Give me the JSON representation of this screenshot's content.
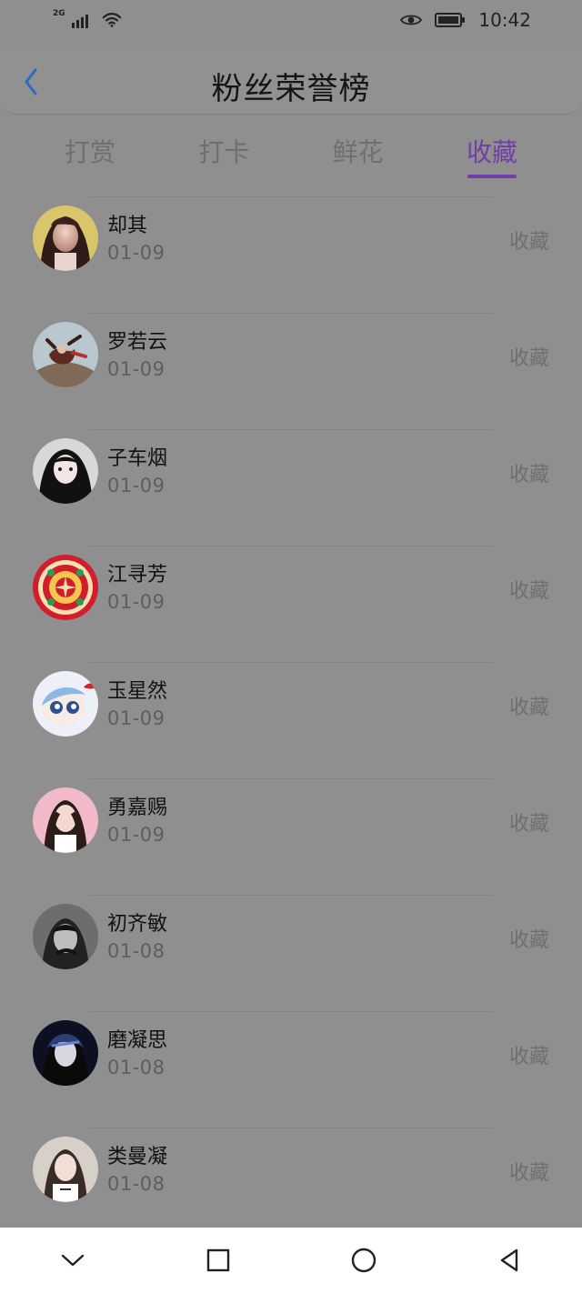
{
  "status_bar": {
    "network": "2G",
    "time": "10:42"
  },
  "header": {
    "title": "粉丝荣誉榜"
  },
  "tabs": [
    {
      "label": "打赏",
      "active": false
    },
    {
      "label": "打卡",
      "active": false
    },
    {
      "label": "鲜花",
      "active": false
    },
    {
      "label": "收藏",
      "active": true
    }
  ],
  "rows": [
    {
      "name": "却其",
      "date": "01-09",
      "action": "收藏",
      "avatar_icon": "avatar-photo"
    },
    {
      "name": "罗若云",
      "date": "01-09",
      "action": "收藏",
      "avatar_icon": "avatar-photo"
    },
    {
      "name": "子车烟",
      "date": "01-09",
      "action": "收藏",
      "avatar_icon": "avatar-photo"
    },
    {
      "name": "江寻芳",
      "date": "01-09",
      "action": "收藏",
      "avatar_icon": "avatar-photo"
    },
    {
      "name": "玉星然",
      "date": "01-09",
      "action": "收藏",
      "avatar_icon": "avatar-photo"
    },
    {
      "name": "勇嘉赐",
      "date": "01-09",
      "action": "收藏",
      "avatar_icon": "avatar-photo"
    },
    {
      "name": "初齐敏",
      "date": "01-08",
      "action": "收藏",
      "avatar_icon": "avatar-photo"
    },
    {
      "name": "磨凝思",
      "date": "01-08",
      "action": "收藏",
      "avatar_icon": "avatar-photo"
    },
    {
      "name": "类曼凝",
      "date": "01-08",
      "action": "收藏",
      "avatar_icon": "avatar-photo"
    }
  ],
  "nav": {
    "buttons": [
      {
        "icon": "chevron-down-icon"
      },
      {
        "icon": "square-icon"
      },
      {
        "icon": "circle-icon"
      },
      {
        "icon": "back-triangle-icon"
      }
    ]
  },
  "colors": {
    "overlay_bg": "#8f8f8f",
    "accent": "#6f3fa7",
    "text": "#111111",
    "subtext": "#5e5e5e",
    "navbar": "#ffffff"
  }
}
